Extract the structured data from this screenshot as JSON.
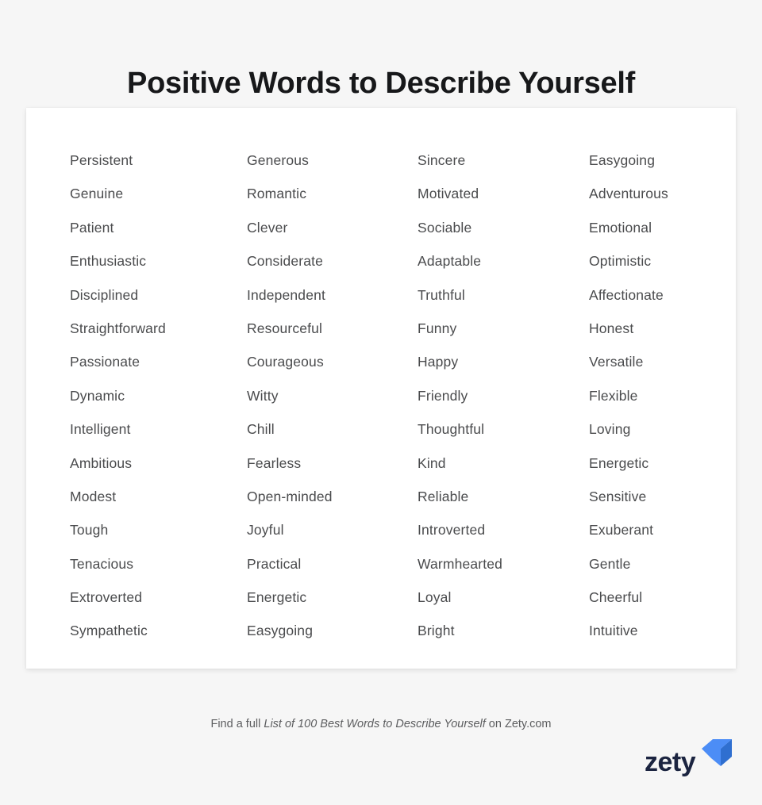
{
  "page": {
    "title": "Positive Words to Describe Yourself",
    "background_color": "#f6f6f6",
    "card_background_color": "#ffffff",
    "title_color": "#17181a",
    "word_color": "#4a4b4d"
  },
  "columns": [
    {
      "index": 1,
      "words": [
        "Persistent",
        "Genuine",
        "Patient",
        "Enthusiastic",
        "Disciplined",
        "Straightforward",
        "Passionate",
        "Dynamic",
        "Intelligent",
        "Ambitious",
        "Modest",
        "Tough",
        "Tenacious",
        "Extroverted",
        "Sympathetic"
      ]
    },
    {
      "index": 2,
      "words": [
        "Generous",
        "Romantic",
        "Clever",
        "Considerate",
        "Independent",
        "Resourceful",
        "Courageous",
        "Witty",
        "Chill",
        "Fearless",
        "Open-minded",
        "Joyful",
        "Practical",
        "Energetic",
        "Easygoing"
      ]
    },
    {
      "index": 3,
      "words": [
        "Sincere",
        "Motivated",
        "Sociable",
        "Adaptable",
        "Truthful",
        "Funny",
        "Happy",
        "Friendly",
        "Thoughtful",
        "Kind",
        "Reliable",
        "Introverted",
        "Warmhearted",
        "Loyal",
        "Bright"
      ]
    },
    {
      "index": 4,
      "words": [
        "Easygoing",
        "Adventurous",
        "Emotional",
        "Optimistic",
        "Affectionate",
        "Honest",
        "Versatile",
        "Flexible",
        "Loving",
        "Energetic",
        "Sensitive",
        "Exuberant",
        "Gentle",
        "Cheerful",
        "Intuitive"
      ]
    }
  ],
  "footer": {
    "prefix": "Find a full ",
    "emphasis": "List of 100 Best Words to Describe Yourself",
    "suffix": " on Zety.com"
  },
  "logo": {
    "wordmark": "zety",
    "mark_name": "zety-chevron-icon",
    "wordmark_color": "#1b2440",
    "mark_color_light": "#4c8df6",
    "mark_color_dark": "#2f6fd0"
  }
}
